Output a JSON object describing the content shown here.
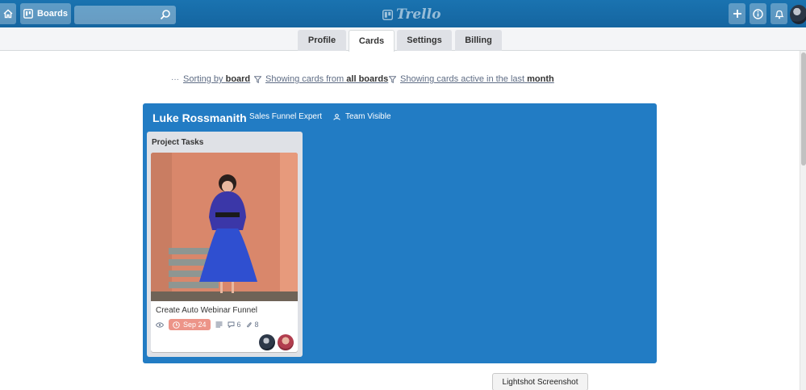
{
  "header": {
    "boards_label": "Boards",
    "search_value": "",
    "logo_text": "Trello"
  },
  "tabs": [
    {
      "label": "Profile",
      "active": false
    },
    {
      "label": "Cards",
      "active": true
    },
    {
      "label": "Settings",
      "active": false
    },
    {
      "label": "Billing",
      "active": false
    }
  ],
  "filters": {
    "sort_prefix": "Sorting by",
    "sort_value": "board",
    "show_from_prefix": "Showing cards from",
    "show_from_value": "all boards",
    "active_prefix": "Showing cards active in the last",
    "active_value": "month"
  },
  "board": {
    "title": "Luke Rossmanith",
    "subtitle": "Sales Funnel Expert",
    "visibility": "Team Visible",
    "lists": [
      {
        "title": "Project Tasks",
        "cards": [
          {
            "title": "Create Auto Webinar Funnel",
            "due": "Sep 24",
            "comments": "6",
            "attachments": "8"
          }
        ]
      }
    ]
  },
  "lightshot_label": "Lightshot Screenshot",
  "colors": {
    "header_bg": "#1565a0",
    "board_bg": "#227cc4",
    "due_badge": "#ec9488"
  },
  "icons": [
    "home-icon",
    "boards-icon",
    "search-icon",
    "trello-logo-icon",
    "plus-icon",
    "info-icon",
    "bell-icon",
    "ellipsis-icon",
    "filter-icon",
    "team-icon",
    "eye-icon",
    "clock-icon",
    "description-icon",
    "comment-icon",
    "attachment-icon"
  ]
}
